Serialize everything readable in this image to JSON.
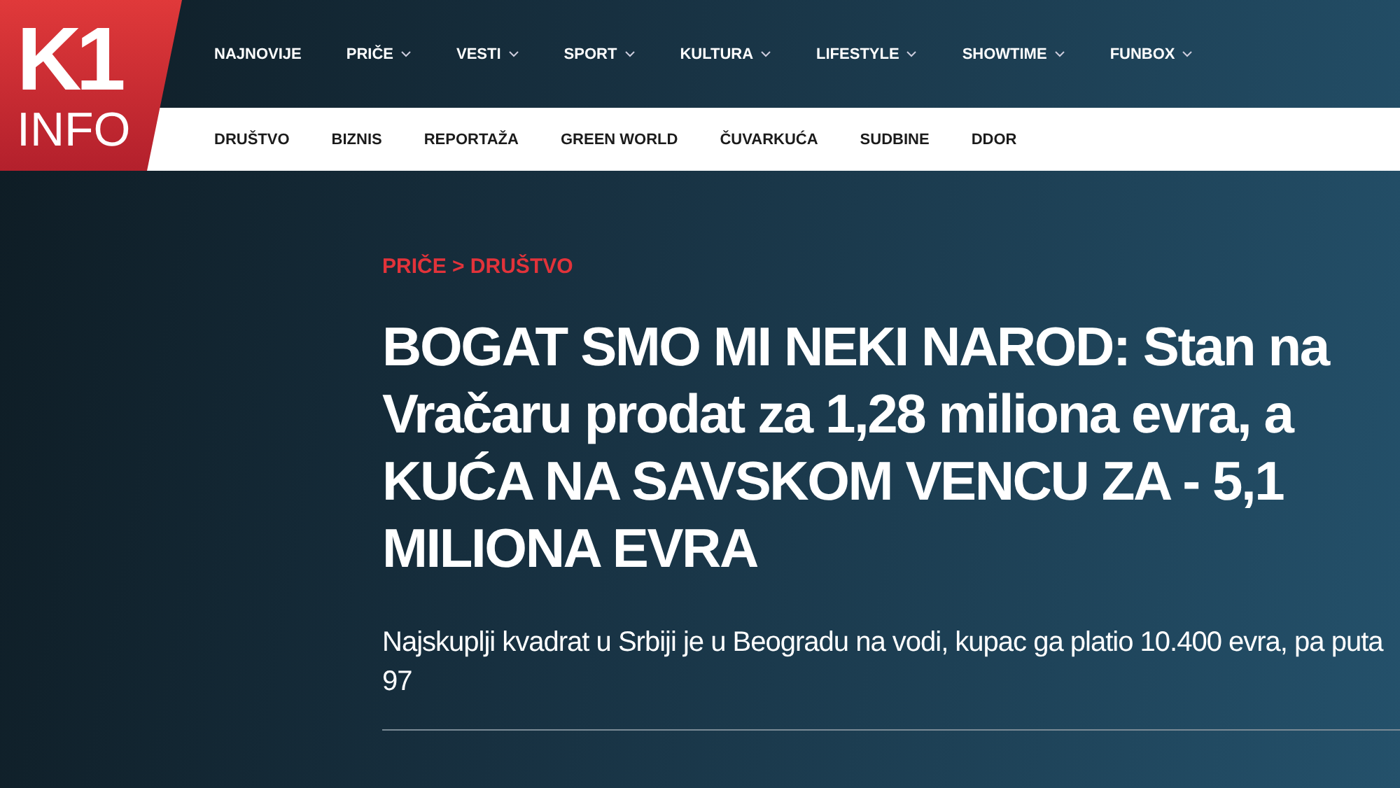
{
  "logo": {
    "top": "K1",
    "bottom": "INFO"
  },
  "main_nav": [
    {
      "label": "NAJNOVIJE",
      "has_menu": false
    },
    {
      "label": "PRIČE",
      "has_menu": true
    },
    {
      "label": "VESTI",
      "has_menu": true
    },
    {
      "label": "SPORT",
      "has_menu": true
    },
    {
      "label": "KULTURA",
      "has_menu": true
    },
    {
      "label": "LIFESTYLE",
      "has_menu": true
    },
    {
      "label": "SHOWTIME",
      "has_menu": true
    },
    {
      "label": "FUNBOX",
      "has_menu": true
    }
  ],
  "sub_nav": [
    "DRUŠTVO",
    "BIZNIS",
    "REPORTAŽA",
    "GREEN WORLD",
    "ČUVARKUĆA",
    "SUDBINE",
    "DDOR"
  ],
  "article": {
    "breadcrumb": "PRIČE > DRUŠTVO",
    "headline": "BOGAT SMO MI NEKI NAROD: Stan na Vračaru prodat za 1,28 miliona evra, a KUĆA NA SAVSKOM VENCU ZA - 5,1 MILIONA EVRA",
    "lead": "Najskuplji kvadrat u Srbiji je u Beogradu na vodi, kupac ga platio 10.400 evra, pa puta 97"
  }
}
